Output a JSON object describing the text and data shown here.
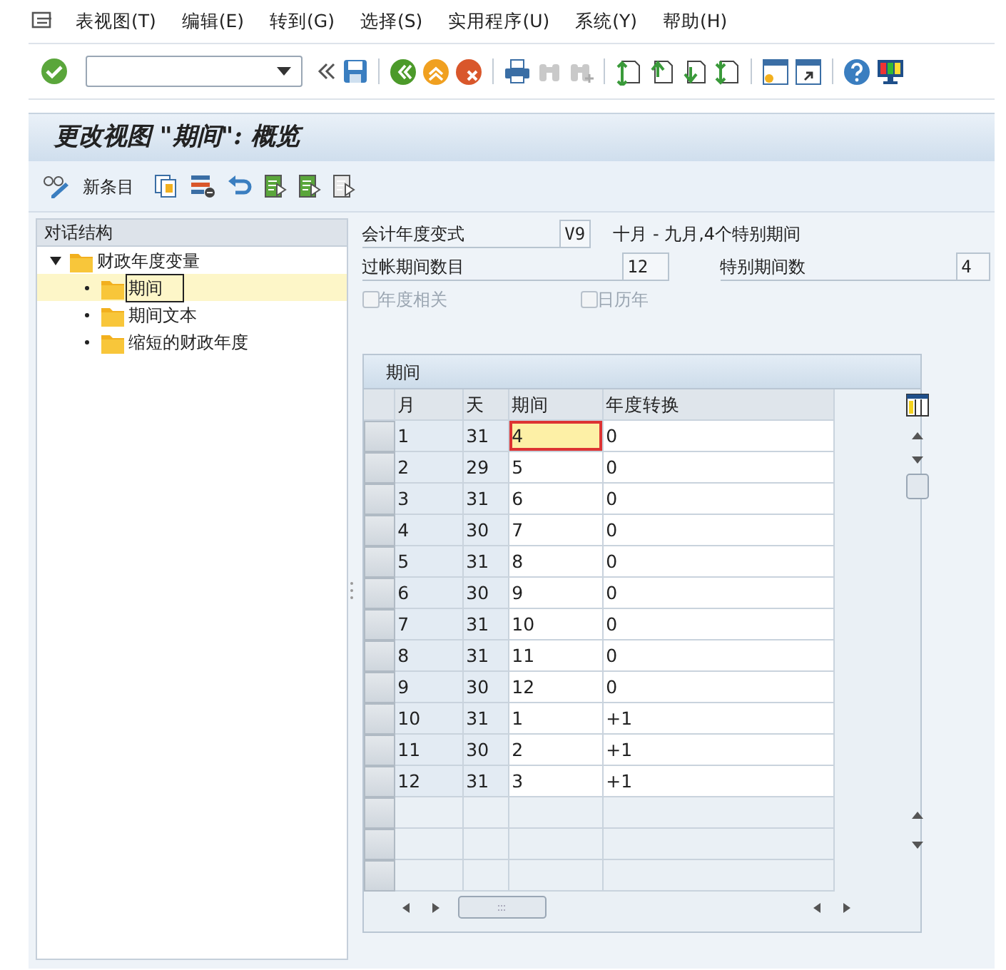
{
  "menu": [
    "表视图(T)",
    "编辑(E)",
    "转到(G)",
    "选择(S)",
    "实用程序(U)",
    "系统(Y)",
    "帮助(H)"
  ],
  "title": "更改视图 \"期间\": 概览",
  "app_toolbar": {
    "new_entries": "新条目"
  },
  "tree": {
    "header": "对话结构",
    "items": [
      {
        "label": "财政年度变量",
        "expanded": true,
        "selected": false,
        "children": [
          {
            "label": "期间",
            "selected": true
          },
          {
            "label": "期间文本",
            "selected": false
          },
          {
            "label": "缩短的财政年度",
            "selected": false
          }
        ]
      }
    ]
  },
  "fields": [
    {
      "label": "会计年度变式",
      "value": "V9",
      "description": "十月 - 九月,4个特别期间"
    },
    {
      "label": "过帐期间数目",
      "value": "12"
    },
    {
      "label": "特别期间数",
      "value": "4"
    }
  ],
  "checkboxes": [
    {
      "label": "年度相关",
      "checked": false,
      "disabled": true
    },
    {
      "label": "日历年",
      "checked": false,
      "disabled": true
    }
  ],
  "table": {
    "title": "期间",
    "columns": [
      {
        "label": "月",
        "editable": false
      },
      {
        "label": "天",
        "editable": false
      },
      {
        "label": "期间",
        "editable": true
      },
      {
        "label": "年度转换",
        "editable": true
      }
    ],
    "rows": [
      {
        "cells": [
          "1",
          "31",
          "4",
          "0"
        ],
        "focused": true
      },
      {
        "cells": [
          "2",
          "29",
          "5",
          "0"
        ],
        "focused": false
      },
      {
        "cells": [
          "3",
          "31",
          "6",
          "0"
        ],
        "focused": false
      },
      {
        "cells": [
          "4",
          "30",
          "7",
          "0"
        ],
        "focused": false
      },
      {
        "cells": [
          "5",
          "31",
          "8",
          "0"
        ],
        "focused": false
      },
      {
        "cells": [
          "6",
          "30",
          "9",
          "0"
        ],
        "focused": false
      },
      {
        "cells": [
          "7",
          "31",
          "10",
          "0"
        ],
        "focused": false
      },
      {
        "cells": [
          "8",
          "31",
          "11",
          "0"
        ],
        "focused": false
      },
      {
        "cells": [
          "9",
          "30",
          "12",
          "0"
        ],
        "focused": false
      },
      {
        "cells": [
          "10",
          "31",
          "1",
          "+1"
        ],
        "focused": false
      },
      {
        "cells": [
          "11",
          "30",
          "2",
          "+1"
        ],
        "focused": false
      },
      {
        "cells": [
          "12",
          "31",
          "3",
          "+1"
        ],
        "focused": false
      }
    ]
  }
}
